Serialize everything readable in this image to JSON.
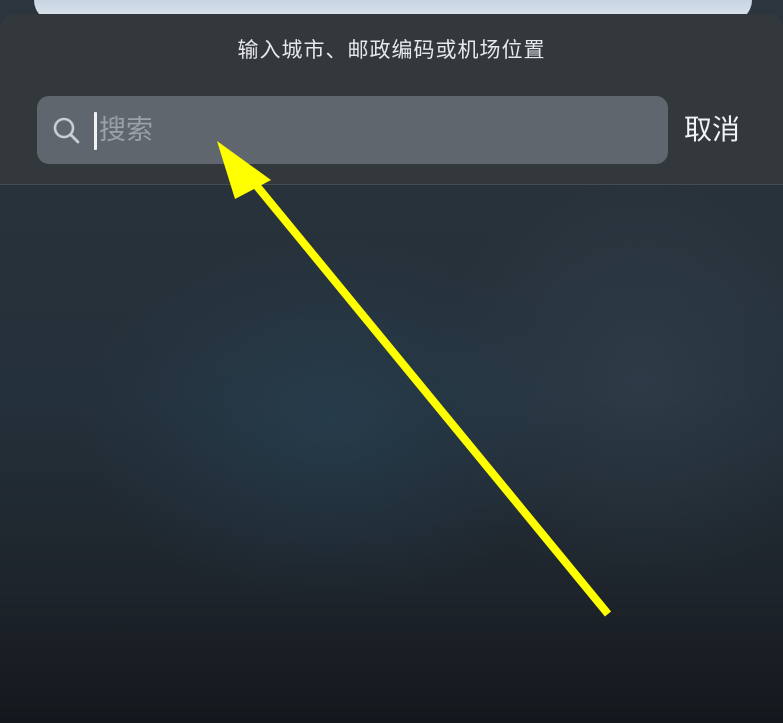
{
  "header": {
    "title": "输入城市、邮政编码或机场位置"
  },
  "search": {
    "placeholder": "搜索",
    "value": "",
    "icon": "search-icon"
  },
  "cancel_label": "取消",
  "annotation": {
    "type": "arrow",
    "color": "#ffff00",
    "points_to": "search-input"
  }
}
